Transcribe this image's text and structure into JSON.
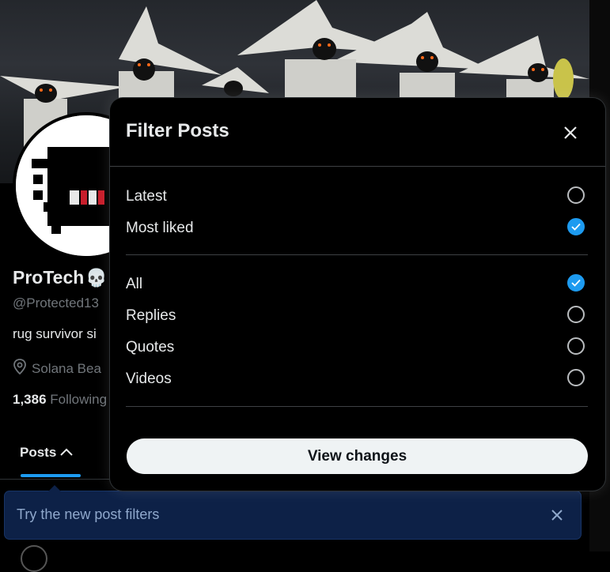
{
  "profile": {
    "name": "ProTech",
    "name_emoji": "💀",
    "handle": "@Protected13",
    "bio": "rug survivor si",
    "location": "Solana Bea",
    "following_count": "1,386",
    "following_label": "Following"
  },
  "tabs": {
    "posts_label": "Posts"
  },
  "toast": {
    "text": "Try the new post filters"
  },
  "filter_modal": {
    "title": "Filter Posts",
    "sort_options": [
      {
        "label": "Latest",
        "selected": false
      },
      {
        "label": "Most liked",
        "selected": true
      }
    ],
    "type_options": [
      {
        "label": "All",
        "selected": true
      },
      {
        "label": "Replies",
        "selected": false
      },
      {
        "label": "Quotes",
        "selected": false
      },
      {
        "label": "Videos",
        "selected": false
      }
    ],
    "apply_label": "View changes"
  },
  "colors": {
    "accent": "#1d9bf0",
    "background": "#000000",
    "toast_bg": "#0d2147"
  },
  "icons": {
    "close": "close-icon",
    "check": "check-icon",
    "location": "location-pin-icon",
    "chevron": "chevron-up-icon"
  }
}
